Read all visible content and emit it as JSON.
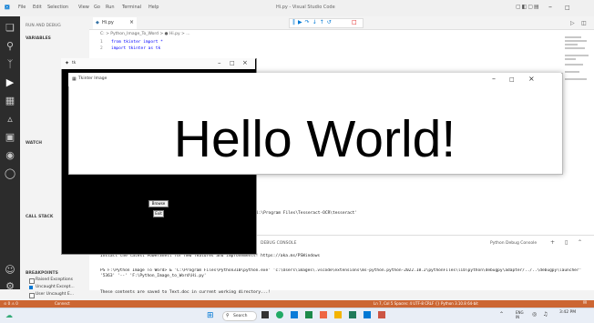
{
  "app": {
    "title": "Hi.py - Visual Studio Code",
    "menu": [
      "File",
      "Edit",
      "Selection",
      "View",
      "Go",
      "Run",
      "Terminal",
      "Help"
    ]
  },
  "sidebar": {
    "header": "RUN AND DEBUG",
    "sections": [
      "VARIABLES",
      "WATCH",
      "CALL STACK",
      "BREAKPOINTS"
    ],
    "breakpoints": [
      "Raised Exceptions",
      "Uncaught Except...",
      "User Uncaught E..."
    ]
  },
  "editor": {
    "tab": "Hi.py",
    "breadcrumb": "C: > Python_Image_To_Word > ● Hi.py > ...",
    "lines": [
      {
        "num": "1",
        "text": "from tkinter import *"
      },
      {
        "num": "2",
        "text": "import tkinter as tk"
      }
    ]
  },
  "tk_window": {
    "title": "tk",
    "buttons": [
      "Browse",
      "Exit"
    ]
  },
  "image_window": {
    "title": "Tkinter Image",
    "text": "Hello World!"
  },
  "terminal": {
    "tab": "DEBUG CONSOLE",
    "tool_label": "Python Debug Console",
    "partial_line": "l:\\Program Files\\Tesseract-OCR\\tesseract'",
    "lines": [
      "Install the latest PowerShell for new features and improvements! https://aka.ms/PSWindows",
      "PS F:\\Python Image To Word> & 'C:\\Program Files\\Python310\\python.exe' 'c:\\Users\\images\\.vscode\\extensions\\ms-python.python-2022.18.2\\pythonFiles\\lib\\python\\debugpy\\adapter/../..\\debugpy\\launcher' '5363' '--' 'F:\\Python_Image_to_Word\\Hi.py'",
      "These contents are saved to Text.doc in current working directory...!"
    ]
  },
  "status": {
    "left": "Connect",
    "right": "Ln 7, Col 5   Spaces: 4   UTF-8   CRLF   {} Python   3.10.8 64-bit"
  },
  "taskbar": {
    "search": "Search",
    "clock_time": "3:42 PM",
    "lang": "ENG IN"
  },
  "colors": {
    "status_bar": "#cc6633",
    "activity_bar": "#2c2c2c",
    "accent": "#0078d4"
  }
}
